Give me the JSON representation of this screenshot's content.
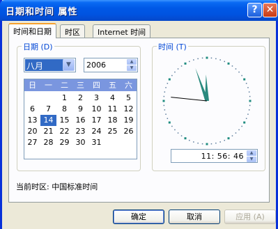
{
  "window": {
    "title": "日期和时间 属性"
  },
  "titlebar_buttons": {
    "help": "?",
    "close": "✕"
  },
  "tabs": [
    {
      "label": "时间和日期",
      "active": true
    },
    {
      "label": "时区",
      "active": false
    },
    {
      "label": "Internet 时间",
      "active": false
    }
  ],
  "date_group": {
    "label": "日期 (D)",
    "month": "八月",
    "year": "2006",
    "weekday_headers": [
      "日",
      "一",
      "二",
      "三",
      "四",
      "五",
      "六"
    ],
    "days": [
      "",
      "",
      "",
      "1",
      "2",
      "3",
      "4",
      "5",
      "6",
      "7",
      "8",
      "9",
      "10",
      "11",
      "12",
      "13",
      "14",
      "15",
      "16",
      "17",
      "18",
      "19",
      "20",
      "21",
      "22",
      "23",
      "24",
      "25",
      "26",
      "27",
      "28",
      "29",
      "30",
      "31"
    ],
    "selected_day": "14"
  },
  "time_group": {
    "label": "时间 (T)",
    "time": "11: 56: 46",
    "clock": {
      "hour": 11,
      "minute": 56,
      "second": 46,
      "hand_color": "#2a8a7e",
      "second_hand_color": "#000000"
    }
  },
  "timezone": {
    "text": "当前时区: 中国标准时间"
  },
  "buttons": {
    "ok": "确定",
    "cancel": "取消",
    "apply": "应用 (A)"
  }
}
